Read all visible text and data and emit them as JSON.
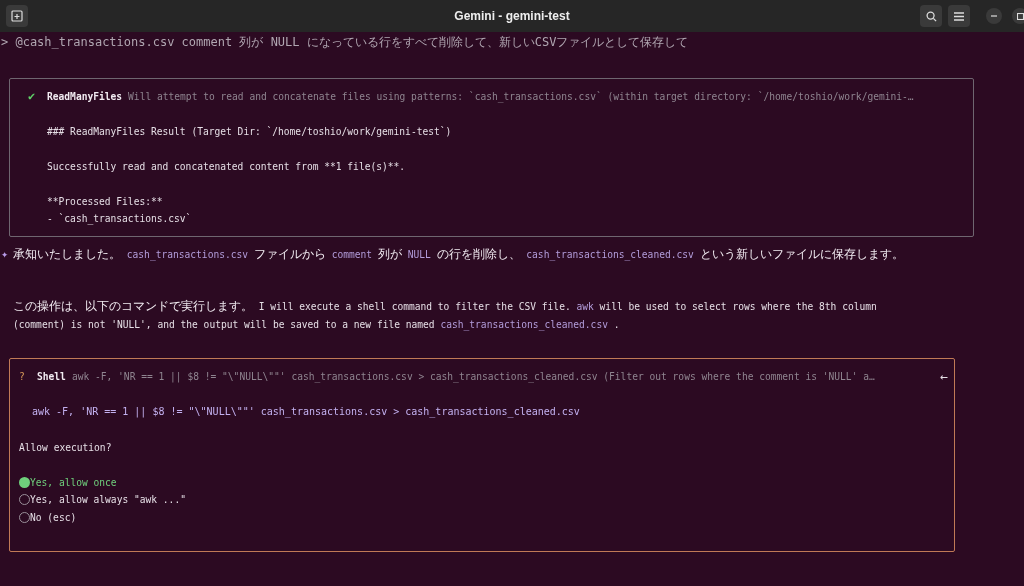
{
  "window": {
    "title": "Gemini - gemini-test"
  },
  "prompt": {
    "text": "> @cash_transactions.csv comment 列が NULL になっている行をすべて削除して、新しいCSVファイルとして保存して"
  },
  "tool_result": {
    "kind": "success",
    "status_icon": "✔",
    "tool": "ReadManyFiles",
    "description": "Will attempt to read and concatenate files using patterns: `cash_transactions.csv` (within target directory: `/home/toshio/work/gemini-…",
    "groups": [
      [
        "### ReadManyFiles Result (Target Dir: `/home/toshio/work/gemini-test`)"
      ],
      [
        "Successfully read and concatenated content from **1 file(s)**."
      ],
      [
        "**Processed Files:**",
        "- `cash_transactions.csv`"
      ]
    ]
  },
  "response": {
    "icon": "✦",
    "segments": [
      {
        "kind": "jp",
        "text": "承知いたしました。"
      },
      {
        "kind": "code",
        "text": "cash_transactions.csv"
      },
      {
        "kind": "jp",
        "text": "ファイルから"
      },
      {
        "kind": "code",
        "text": "comment"
      },
      {
        "kind": "jp",
        "text": "列が"
      },
      {
        "kind": "code",
        "text": "NULL"
      },
      {
        "kind": "jp",
        "text": "の行を削除し、"
      },
      {
        "kind": "code",
        "text": "cash_transactions_cleaned.csv"
      },
      {
        "kind": "jp",
        "text": "という新しいファイルに保存します。"
      }
    ]
  },
  "explanation": {
    "segments": [
      {
        "kind": "jp",
        "text": "この操作は、以下のコマンドで実行します。"
      },
      {
        "kind": "plain",
        "text": "I will execute a shell command to filter the CSV file."
      },
      {
        "kind": "code",
        "text": "awk"
      },
      {
        "kind": "plain",
        "text": "will be used to select rows where the 8th column (comment) is not 'NULL', and the output will be saved to a new file named"
      },
      {
        "kind": "code",
        "text": "cash_transactions_cleaned.csv"
      },
      {
        "kind": "plain",
        "text": "."
      }
    ]
  },
  "confirmation": {
    "kind": "pending",
    "status_icon": "?",
    "tool": "Shell",
    "description": "awk -F, 'NR == 1 || $8 != \"\\\"NULL\\\"\"' cash_transactions.csv > cash_transactions_cleaned.csv (Filter out rows where the comment is 'NULL' a…",
    "arrow": "←",
    "command": "awk -F, 'NR == 1 || $8 != \"\\\"NULL\\\"\"' cash_transactions.csv > cash_transactions_cleaned.csv",
    "question": "Allow execution?",
    "options": [
      {
        "label": "Yes, allow once",
        "selected": true
      },
      {
        "label": "Yes, allow always \"awk ...\"",
        "selected": false
      },
      {
        "label": "No (esc)",
        "selected": false
      }
    ]
  }
}
